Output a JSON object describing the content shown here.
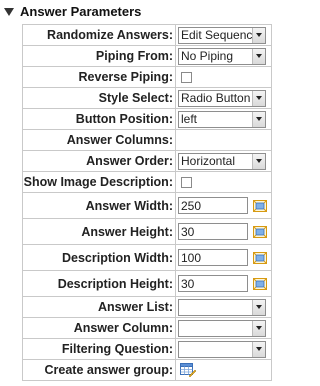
{
  "section": {
    "title": "Answer Parameters"
  },
  "rows": {
    "randomize": {
      "label": "Randomize Answers:",
      "value": "Edit Sequence"
    },
    "piping_from": {
      "label": "Piping From:",
      "value": "No Piping"
    },
    "reverse_piping": {
      "label": "Reverse Piping:",
      "checked": false
    },
    "style_select": {
      "label": "Style Select:",
      "value": "Radio Button"
    },
    "button_position": {
      "label": "Button Position:",
      "value": "left"
    },
    "answer_columns": {
      "label": "Answer Columns:"
    },
    "answer_order": {
      "label": "Answer Order:",
      "value": "Horizontal"
    },
    "show_image_description": {
      "label": "Show Image Description:",
      "checked": false
    },
    "answer_width": {
      "label": "Answer Width:",
      "value": "250"
    },
    "answer_height": {
      "label": "Answer Height:",
      "value": "30"
    },
    "description_width": {
      "label": "Description Width:",
      "value": "100"
    },
    "description_height": {
      "label": "Description Height:",
      "value": "30"
    },
    "answer_list": {
      "label": "Answer List:",
      "value": ""
    },
    "answer_column": {
      "label": "Answer Column:",
      "value": ""
    },
    "filtering_question": {
      "label": "Filtering Question:",
      "value": ""
    },
    "create_answer_group": {
      "label": "Create answer group:"
    }
  },
  "icons": {
    "collapse": "triangle-down-icon",
    "resize": "resize-icon",
    "group": "table-edit-icon"
  },
  "colors": {
    "border": "#c9c9c9",
    "resize_icon": "#e0a81a"
  }
}
